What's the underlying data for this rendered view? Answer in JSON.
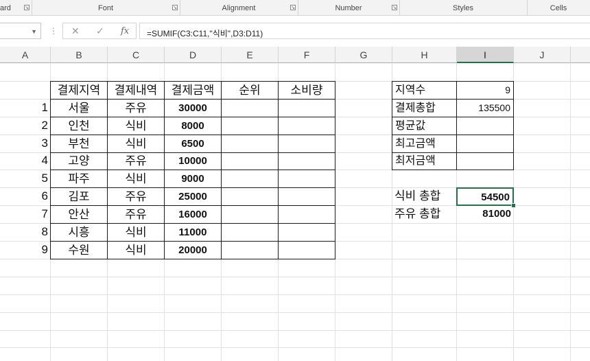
{
  "ribbon": {
    "groups": [
      {
        "label": "ard",
        "launcher": true
      },
      {
        "label": "Font",
        "launcher": true
      },
      {
        "label": "Alignment",
        "launcher": true
      },
      {
        "label": "Number",
        "launcher": true
      },
      {
        "label": "Styles",
        "launcher": false
      },
      {
        "label": "Cells",
        "launcher": false
      }
    ]
  },
  "formula_bar": {
    "name_box": "",
    "cancel_glyph": "✕",
    "enter_glyph": "✓",
    "fx_label": "fx",
    "formula": "=SUMIF(C3:C11,\"식비\",D3:D11)"
  },
  "columns": [
    "A",
    "B",
    "C",
    "D",
    "E",
    "F",
    "G",
    "H",
    "I",
    "J"
  ],
  "selected_column": "I",
  "table": {
    "headers": [
      "결제지역",
      "결제내역",
      "결제금액",
      "순위",
      "소비량"
    ],
    "rows": [
      {
        "no": "1",
        "region": "서울",
        "type": "주유",
        "amount": "30000",
        "rank": "",
        "usage": ""
      },
      {
        "no": "2",
        "region": "인천",
        "type": "식비",
        "amount": "8000",
        "rank": "",
        "usage": ""
      },
      {
        "no": "3",
        "region": "부천",
        "type": "식비",
        "amount": "6500",
        "rank": "",
        "usage": ""
      },
      {
        "no": "4",
        "region": "고양",
        "type": "주유",
        "amount": "10000",
        "rank": "",
        "usage": ""
      },
      {
        "no": "5",
        "region": "파주",
        "type": "식비",
        "amount": "9000",
        "rank": "",
        "usage": ""
      },
      {
        "no": "6",
        "region": "김포",
        "type": "주유",
        "amount": "25000",
        "rank": "",
        "usage": ""
      },
      {
        "no": "7",
        "region": "안산",
        "type": "주유",
        "amount": "16000",
        "rank": "",
        "usage": ""
      },
      {
        "no": "8",
        "region": "시흥",
        "type": "식비",
        "amount": "11000",
        "rank": "",
        "usage": ""
      },
      {
        "no": "9",
        "region": "수원",
        "type": "식비",
        "amount": "20000",
        "rank": "",
        "usage": ""
      }
    ]
  },
  "summary": [
    {
      "label": "지역수",
      "value": "9"
    },
    {
      "label": "결제총합",
      "value": "135500"
    },
    {
      "label": "평균값",
      "value": ""
    },
    {
      "label": "최고금액",
      "value": ""
    },
    {
      "label": "최저금액",
      "value": ""
    }
  ],
  "totals": [
    {
      "label": "식비 총합",
      "value": "54500"
    },
    {
      "label": "주유 총합",
      "value": "81000"
    }
  ],
  "colors": {
    "accent": "#217346"
  }
}
